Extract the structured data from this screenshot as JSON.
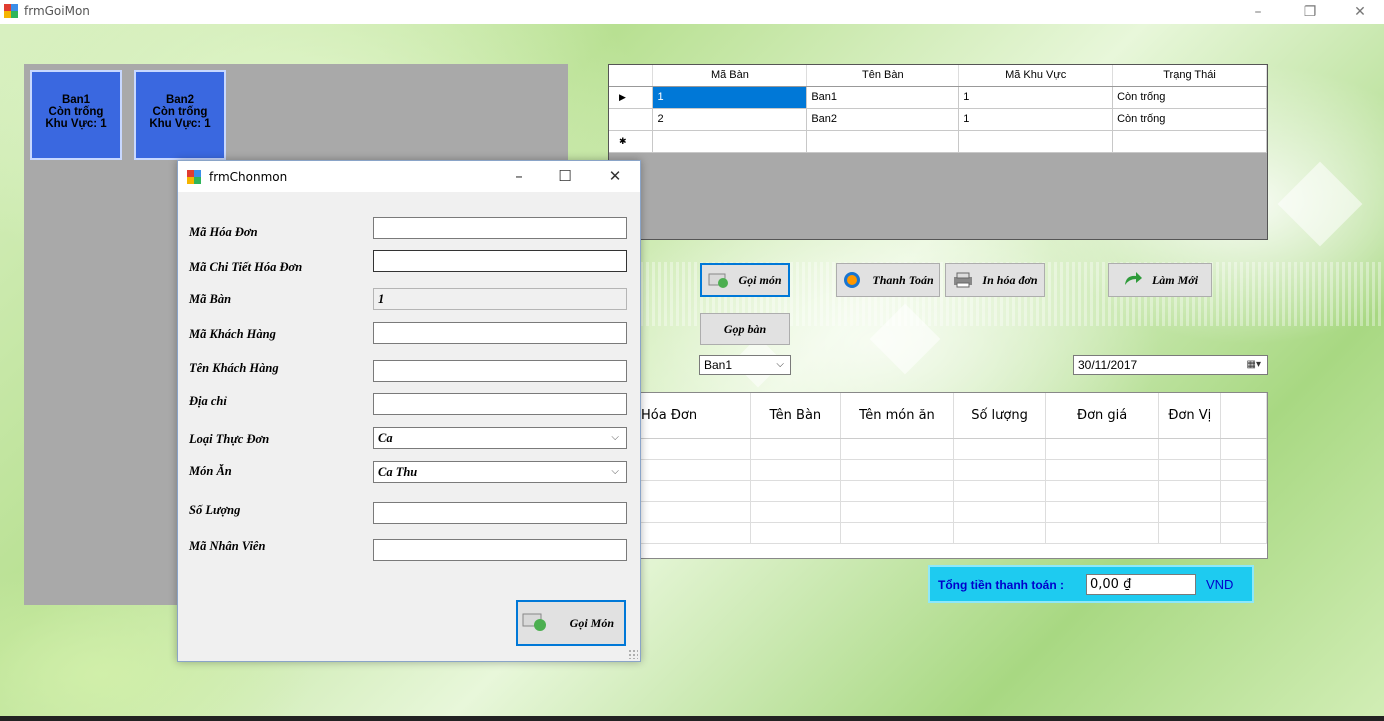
{
  "main_window": {
    "title": "frmGoiMon"
  },
  "tables": [
    {
      "name": "Ban1",
      "status": "Còn trống",
      "area": "Khu Vực: 1"
    },
    {
      "name": "Ban2",
      "status": "Còn trống",
      "area": "Khu Vực: 1"
    }
  ],
  "table_grid": {
    "columns": [
      "Mã Bàn",
      "Tên Bàn",
      "Mã Khu Vực",
      "Trạng Thái"
    ],
    "rows": [
      [
        "1",
        "Ban1",
        "1",
        "Còn trống"
      ],
      [
        "2",
        "Ban2",
        "1",
        "Còn trống"
      ]
    ]
  },
  "buttons": {
    "goi_mon": "Gọi món",
    "thanh_toan": "Thanh Toán",
    "in_hoa_don": "In hóa đơn",
    "lam_moi": "Làm Mới",
    "gop_ban": "Gọp bàn"
  },
  "table_combo": {
    "selected": "Ban1"
  },
  "date_picker": {
    "value": "30/11/2017"
  },
  "invoice_grid": {
    "columns": [
      "Hóa Đơn",
      "Tên Bàn",
      "Tên món ăn",
      "Số lượng",
      "Đơn giá",
      "Đơn Vị"
    ]
  },
  "total": {
    "label": "Tổng tiền thanh toán :",
    "value": "0,00 ₫",
    "currency": "VND"
  },
  "dialog": {
    "title": "frmChonmon",
    "fields": {
      "ma_hoa_don": {
        "label": "Mã Hóa Đơn",
        "value": ""
      },
      "ma_chi_tiet": {
        "label": "Mã Chi Tiết Hóa Đơn",
        "value": ""
      },
      "ma_ban": {
        "label": "Mã Bàn",
        "value": "1"
      },
      "ma_khach_hang": {
        "label": "Mã Khách Hàng",
        "value": ""
      },
      "ten_khach_hang": {
        "label": "Tên Khách Hàng",
        "value": ""
      },
      "dia_chi": {
        "label": "Địa chỉ",
        "value": ""
      },
      "loai_thuc_don": {
        "label": "Loại Thực Đơn",
        "value": "Ca"
      },
      "mon_an": {
        "label": "Món Ăn",
        "value": "Ca Thu"
      },
      "so_luong": {
        "label": "Số Lượng",
        "value": ""
      },
      "ma_nhan_vien": {
        "label": "Mã Nhân Viên",
        "value": ""
      }
    },
    "submit_label": "Gọi Món"
  }
}
